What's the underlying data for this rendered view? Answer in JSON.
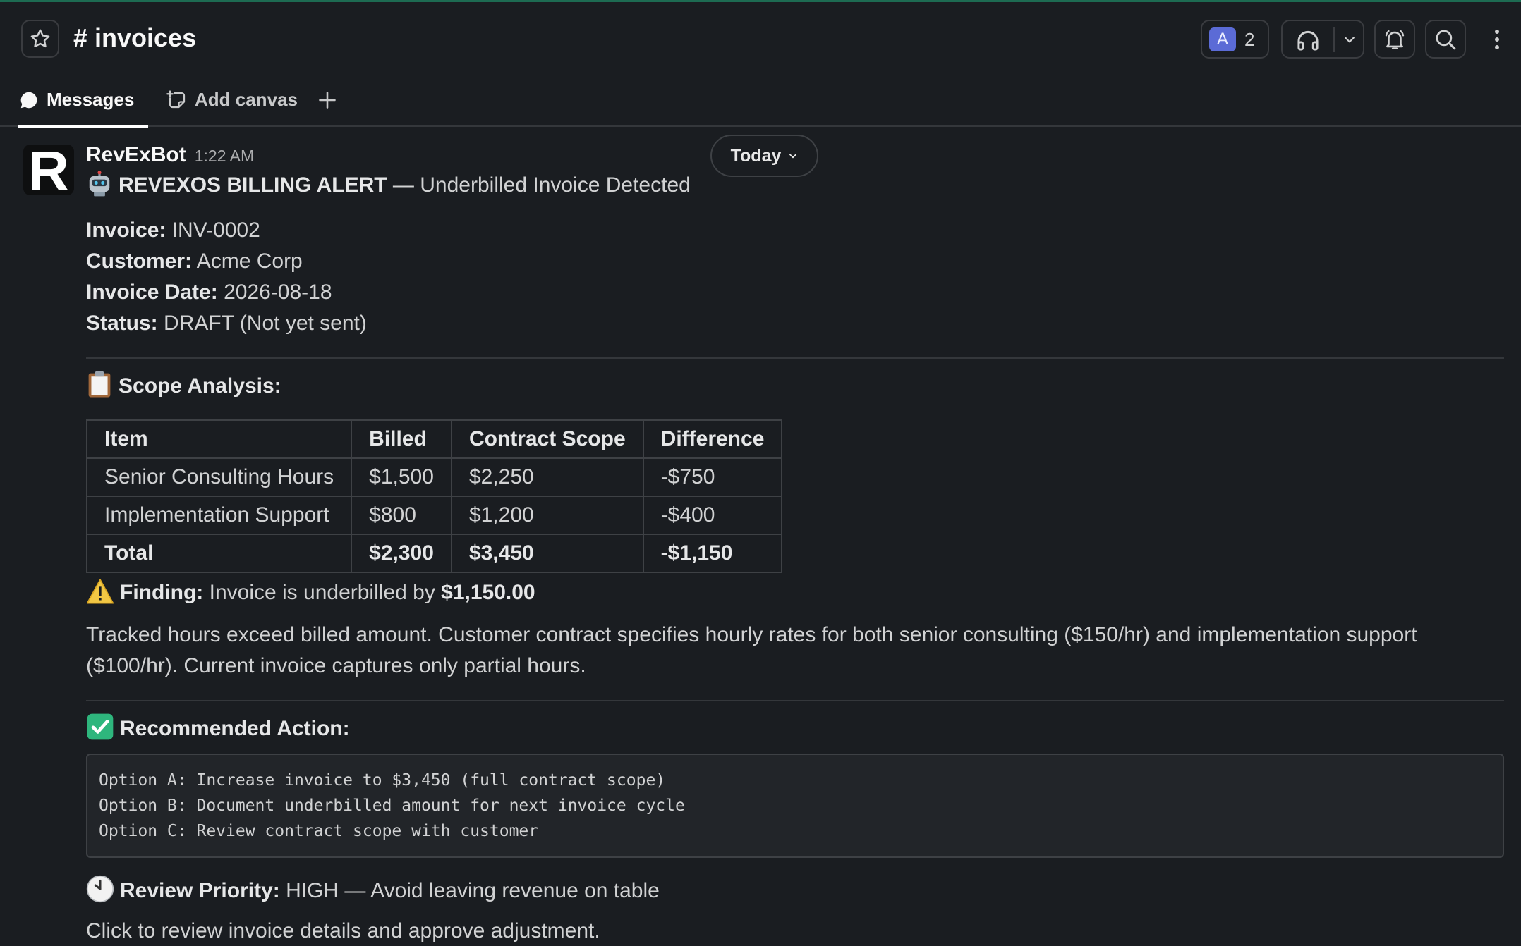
{
  "header": {
    "channel_title": "# invoices",
    "member_avatar_letter": "A",
    "member_count": "2"
  },
  "tabs": [
    {
      "label": "Messages",
      "icon": "message-icon",
      "active": true
    },
    {
      "label": "Add canvas",
      "icon": "canvas-icon",
      "active": false
    },
    {
      "label": "+",
      "icon": "plus-icon",
      "active": false
    }
  ],
  "date_divider": {
    "label": "Today"
  },
  "message": {
    "sender": "RevExBot",
    "avatar_letter": "R",
    "time": "1:22 AM",
    "alert_title": "REVEXOS BILLING ALERT",
    "alert_subtitle": " — Underbilled Invoice Detected",
    "fields": [
      {
        "label": "Invoice:",
        "value": " INV-0002"
      },
      {
        "label": "Customer:",
        "value": " Acme Corp"
      },
      {
        "label": "Invoice Date:",
        "value": " 2026-08-18"
      },
      {
        "label": "Status:",
        "value": " DRAFT (Not yet sent)"
      }
    ],
    "scope_heading": "Scope Analysis:",
    "table": {
      "headers": [
        "Item",
        "Billed",
        "Contract Scope",
        "Difference"
      ],
      "rows": [
        [
          "Senior Consulting Hours",
          "$1,500",
          "$2,250",
          "-$750"
        ],
        [
          "Implementation Support",
          "$800",
          "$1,200",
          "-$400"
        ]
      ],
      "total": [
        "Total",
        "$2,300",
        "$3,450",
        "-$1,150"
      ]
    },
    "finding_label": "Finding:",
    "finding_text": " Invoice is underbilled by ",
    "finding_amount": "$1,150.00",
    "explanation": "Tracked hours exceed billed amount. Customer contract specifies hourly rates for both senior consulting ($150/hr) and implementation support ($100/hr). Current invoice captures only partial hours.",
    "recommended_heading": "Recommended Action:",
    "options": [
      "Option A: Increase invoice to $3,450 (full contract scope)",
      "Option B: Document underbilled amount for next invoice cycle",
      "Option C: Review contract scope with customer"
    ],
    "priority_label": "Review Priority:",
    "priority_text": " HIGH — Avoid leaving revenue on table",
    "cta_text": "Click to review invoice details and approve adjustment."
  },
  "colors": {
    "background": "#1a1d21",
    "accent_avatar": "#5b6bd6",
    "top_border": "#1d6b52",
    "check_green": "#2eb67d",
    "warning_yellow": "#f2c744"
  }
}
